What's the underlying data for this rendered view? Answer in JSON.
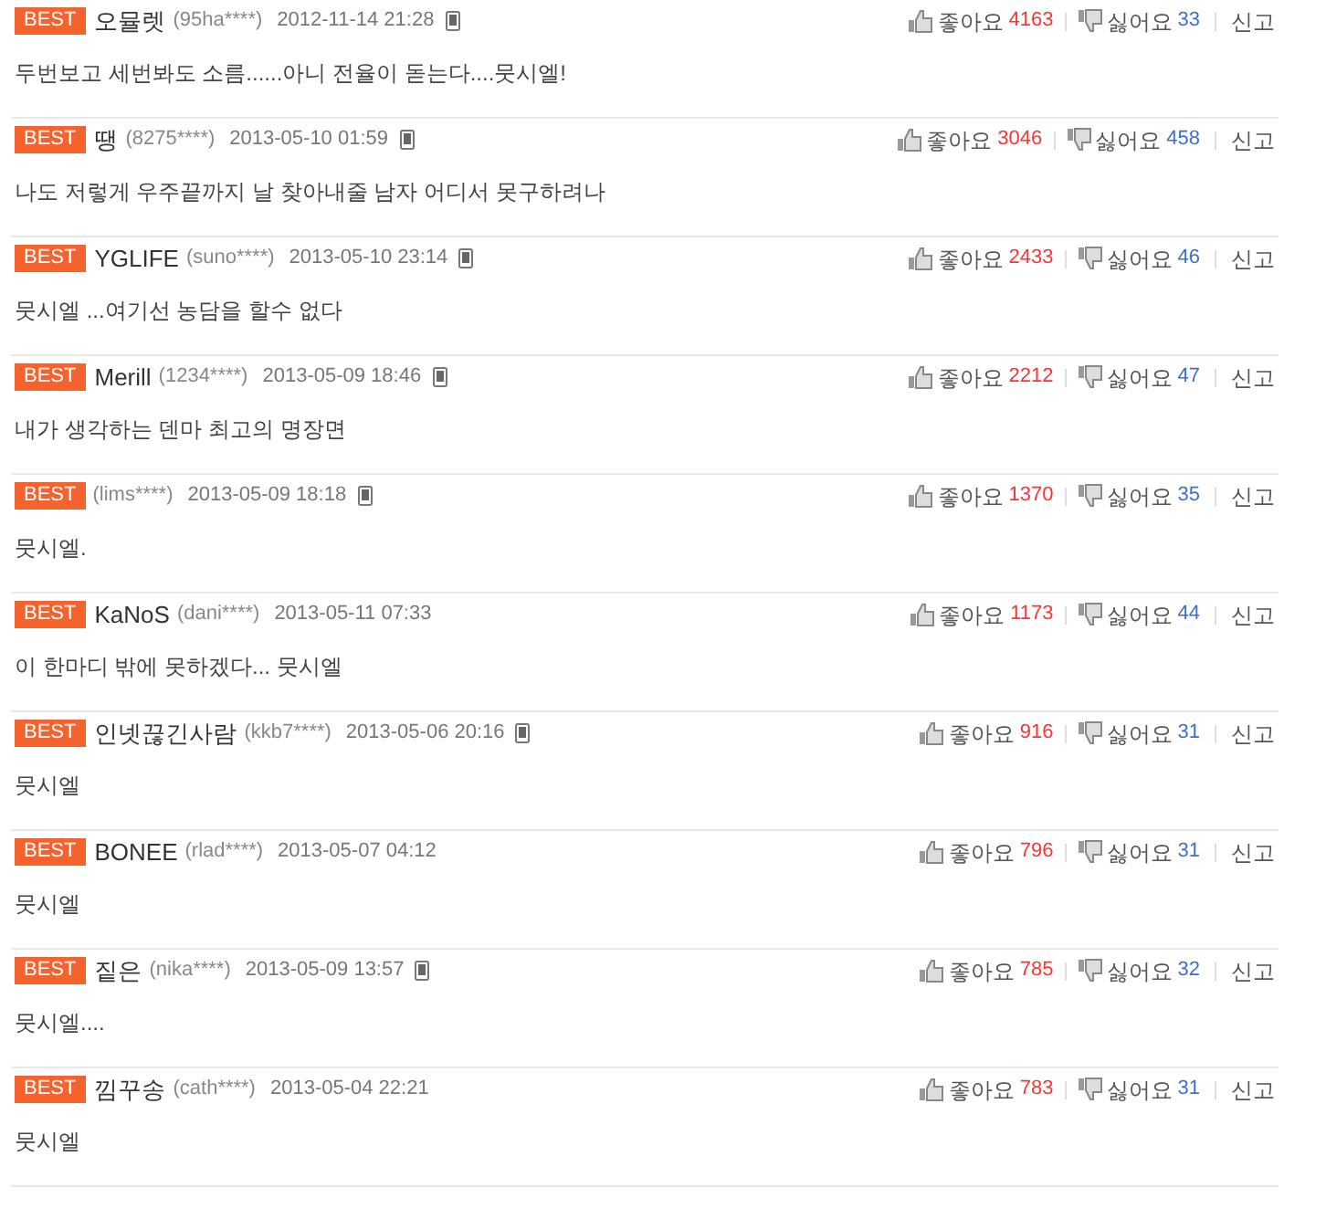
{
  "comments": [
    {
      "badge": "BEST",
      "name": "오뮬렛",
      "user": "(95ha****)",
      "date": "2012-11-14 21:28",
      "mobile": true,
      "text": "두번보고 세번봐도 소름......아니 전율이 돋는다....뭇시엘!",
      "like_label": "좋아요",
      "likes": "4163",
      "dislike_label": "싫어요",
      "dislikes": "33",
      "report": "신고"
    },
    {
      "badge": "BEST",
      "name": "땡",
      "user": "(8275****)",
      "date": "2013-05-10 01:59",
      "mobile": true,
      "text": "나도 저렇게 우주끝까지 날 찾아내줄 남자 어디서 못구하려나",
      "like_label": "좋아요",
      "likes": "3046",
      "dislike_label": "싫어요",
      "dislikes": "458",
      "report": "신고"
    },
    {
      "badge": "BEST",
      "name": "YGLIFE",
      "user": "(suno****)",
      "date": "2013-05-10 23:14",
      "mobile": true,
      "text": "뭇시엘 ...여기선 농담을 할수 없다",
      "like_label": "좋아요",
      "likes": "2433",
      "dislike_label": "싫어요",
      "dislikes": "46",
      "report": "신고"
    },
    {
      "badge": "BEST",
      "name": "Merill",
      "user": "(1234****)",
      "date": "2013-05-09 18:46",
      "mobile": true,
      "text": "내가 생각하는 덴마 최고의 명장면",
      "like_label": "좋아요",
      "likes": "2212",
      "dislike_label": "싫어요",
      "dislikes": "47",
      "report": "신고"
    },
    {
      "badge": "BEST",
      "user": "(lims****)",
      "date": "2013-05-09 18:18",
      "mobile": true,
      "text": "뭇시엘.",
      "like_label": "좋아요",
      "likes": "1370",
      "dislike_label": "싫어요",
      "dislikes": "35",
      "report": "신고"
    },
    {
      "badge": "BEST",
      "name": "KaNoS",
      "user": "(dani****)",
      "date": "2013-05-11 07:33",
      "mobile": false,
      "text": "이 한마디 밖에 못하겠다... 뭇시엘",
      "like_label": "좋아요",
      "likes": "1173",
      "dislike_label": "싫어요",
      "dislikes": "44",
      "report": "신고"
    },
    {
      "badge": "BEST",
      "name": "인넷끊긴사람",
      "user": "(kkb7****)",
      "date": "2013-05-06 20:16",
      "mobile": true,
      "text": "뭇시엘",
      "like_label": "좋아요",
      "likes": "916",
      "dislike_label": "싫어요",
      "dislikes": "31",
      "report": "신고"
    },
    {
      "badge": "BEST",
      "name": "BONEE",
      "user": "(rlad****)",
      "date": "2013-05-07 04:12",
      "mobile": false,
      "text": "뭇시엘",
      "like_label": "좋아요",
      "likes": "796",
      "dislike_label": "싫어요",
      "dislikes": "31",
      "report": "신고"
    },
    {
      "badge": "BEST",
      "name": "짙은",
      "user": "(nika****)",
      "date": "2013-05-09 13:57",
      "mobile": true,
      "text": "뭇시엘....",
      "like_label": "좋아요",
      "likes": "785",
      "dislike_label": "싫어요",
      "dislikes": "32",
      "report": "신고"
    },
    {
      "badge": "BEST",
      "name": "낌꾸송",
      "user": "(cath****)",
      "date": "2013-05-04 22:21",
      "mobile": false,
      "text": "뭇시엘",
      "like_label": "좋아요",
      "likes": "783",
      "dislike_label": "싫어요",
      "dislikes": "31",
      "report": "신고"
    }
  ]
}
